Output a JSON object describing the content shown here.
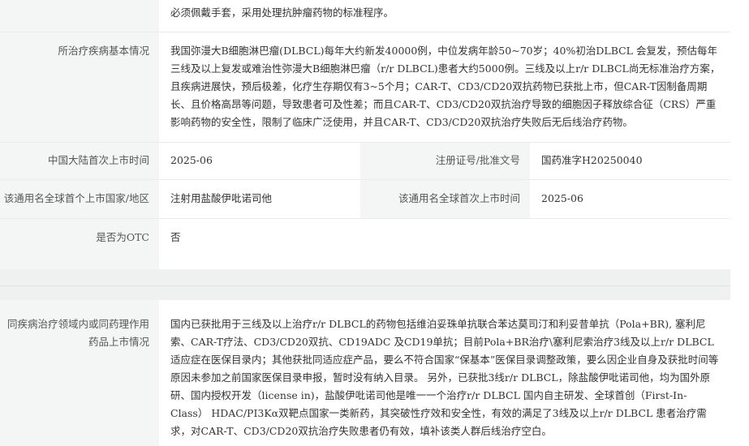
{
  "instructions": {
    "text": "必须佩戴手套，采用处理抗肿瘤药物的标准程序。"
  },
  "disease": {
    "label": "所治疗疾病基本情况",
    "value": "我国弥漫大B细胞淋巴瘤(DLBCL)每年大约新发40000例，中位发病年龄50~70岁；40%初治DLBCL 会复发，预估每年三线及以上复发或难治性弥漫大B细胞淋巴瘤（r/r DLBCL)患者大约5000例。三线及以上r/r DLBCL尚无标准治疗方案，且疾病进展快，预后极差，化疗生存期仅有3~5个月；CAR-T、CD3/CD20双抗药物已获批上市，但CAR-T因制备周期长、且价格高昂等问题，导致患者可及性差；而且CAR-T、CD3/CD20双抗治疗导致的细胞因子释放综合征（CRS）严重影响药物的安全性，限制了临床广泛使用，并且CAR-T、CD3/CD20双抗治疗失败后无后线治疗药物。"
  },
  "launch": {
    "label": "中国大陆首次上市时间",
    "value": "2025-06",
    "approval_label": "注册证号/批准文号",
    "approval_value": "国药准字H20250040"
  },
  "global": {
    "label": "该通用名全球首个上市国家/地区",
    "value": "注射用盐酸伊吡诺司他",
    "first_launch_label": "该通用名全球首次上市时间",
    "first_launch_value": "2025-06"
  },
  "otc": {
    "label": "是否为OTC",
    "value": "否"
  },
  "similar": {
    "label_line1": "同疾病治疗领域内或同药理作用",
    "label_line2": "药品上市情况",
    "value": "国内已获批用于三线及以上治疗r/r DLBCL的药物包括维泊妥珠单抗联合苯达莫司汀和利妥昔单抗（Pola+BR), 塞利尼索、CAR-T疗法、CD3/CD20双抗、CD19ADC 及CD19单抗；目前Pola+BR治疗\\塞利尼索治疗3线及以上r/r DLBCL适应症在医保目录内；其他获批同适应症产品，要么不符合国家“保基本”医保目录调整政策，要么因企业自身及获批时间等原因未参加之前国家医保目录申报，暂时没有纳入目录。 另外，已获批3线r/r DLBCL，除盐酸伊吡诺司他，均为国外原研、国内授权开发（license in)，盐酸伊吡诺司他是唯一一个治疗r/r DLBCL 国内自主研发、全球首创（First-In-Class） HDAC/PI3Kα双靶点国家一类新药，其突破性疗效和安全性，有效的满足了3线及以上r/r DLBCL 患者治疗需求，对CAR-T、CD3/CD20双抗治疗失败患者仍有效，填补该类人群后线治疗空白。"
  }
}
